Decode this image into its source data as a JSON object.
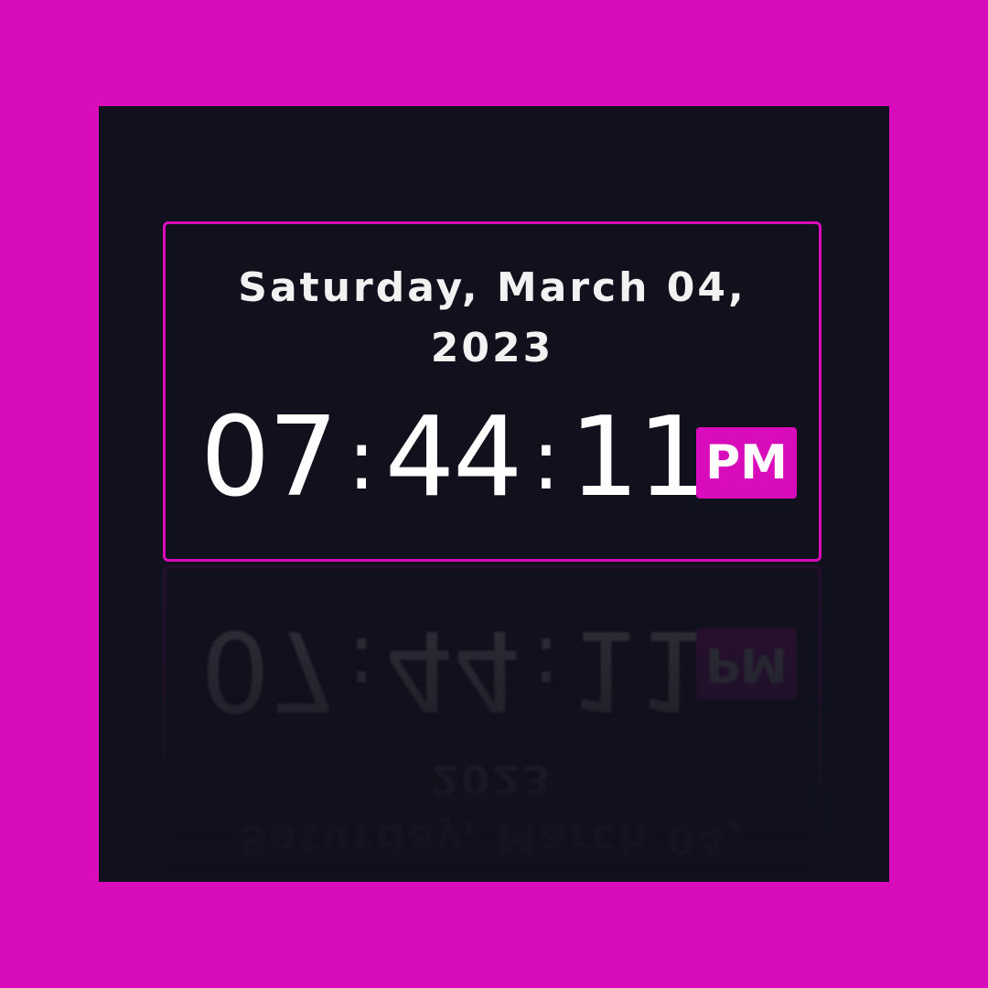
{
  "clock": {
    "date_line1": "Saturday, March 04,",
    "date_line2": "2023",
    "hours": "07",
    "minutes": "44",
    "seconds": "11",
    "separator": ":",
    "ampm": "PM"
  },
  "colors": {
    "background": "#d90cbb",
    "panel": "#11111d",
    "accent": "#d90cbb",
    "text": "#ffffff"
  }
}
